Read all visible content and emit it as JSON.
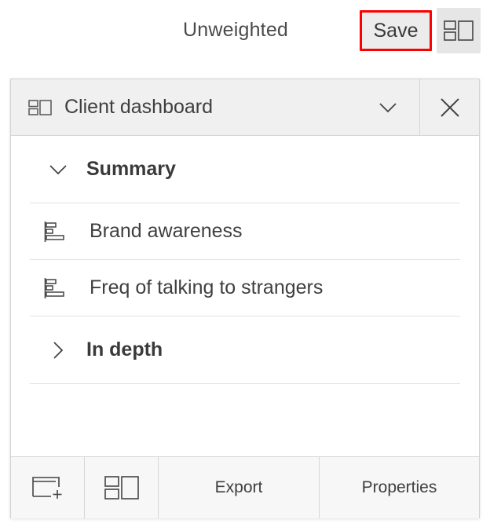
{
  "topbar": {
    "weight_label": "Unweighted",
    "save_label": "Save",
    "layout_toggle_icon": "dashboard-layout-icon",
    "save_highlight_color": "#ff0000"
  },
  "panel": {
    "header": {
      "title": "Client dashboard",
      "title_icon": "dashboard-layout-icon",
      "dropdown_icon": "chevron-down-icon",
      "close_icon": "close-icon"
    },
    "groups": [
      {
        "label": "Summary",
        "expanded": true,
        "items": [
          {
            "label": "Brand awareness",
            "icon": "bar-chart-icon"
          },
          {
            "label": "Freq of talking to strangers",
            "icon": "bar-chart-icon"
          }
        ]
      },
      {
        "label": "In depth",
        "expanded": false,
        "items": []
      }
    ],
    "footer": {
      "new_folder_icon": "add-folder-icon",
      "layout_icon": "dashboard-layout-icon",
      "export_label": "Export",
      "properties_label": "Properties"
    }
  }
}
